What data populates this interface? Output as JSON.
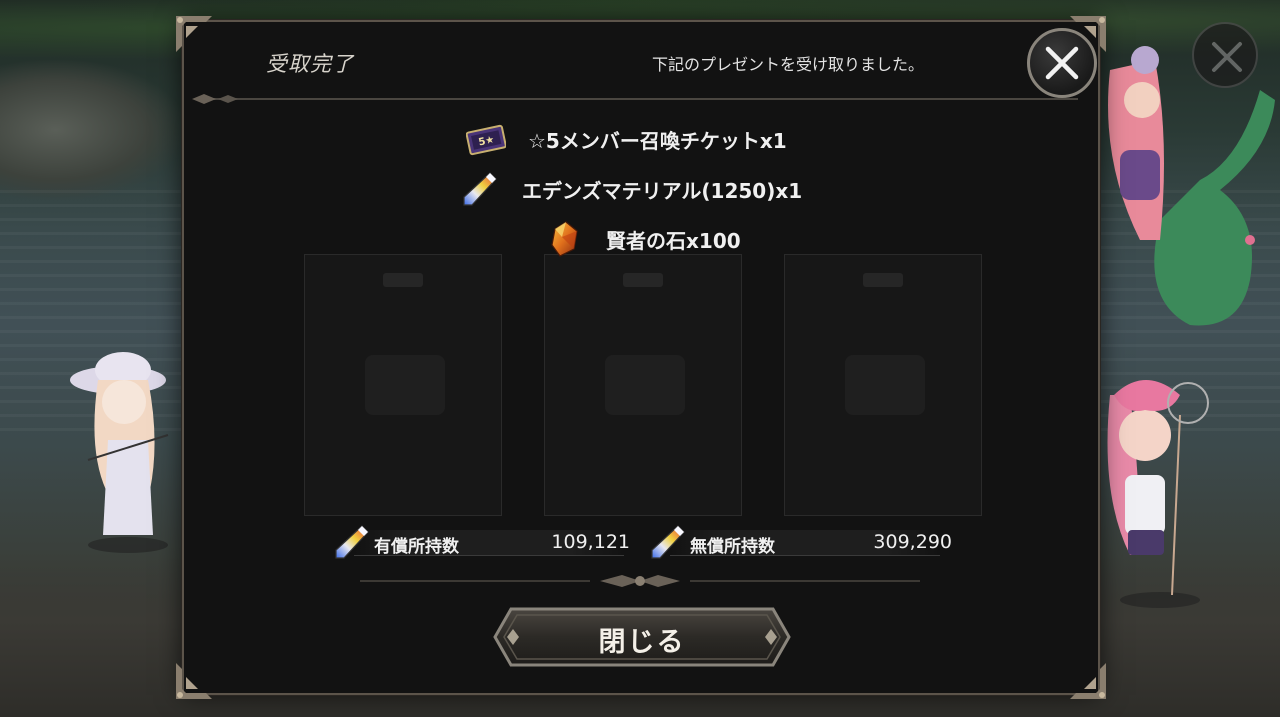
{
  "dialog": {
    "title": "受取完了",
    "subtitle": "下記のプレゼントを受け取りました。",
    "close_icon": "close-x-icon"
  },
  "rewards": [
    {
      "icon": "summon-ticket-icon",
      "label": "☆5メンバー召喚チケットx1",
      "ticket_text": "5★"
    },
    {
      "icon": "eden-material-crystal-icon",
      "label": "エデンズマテリアル(1250)x1"
    },
    {
      "icon": "philosopher-stone-icon",
      "label": "賢者の石x100"
    }
  ],
  "currency": {
    "paid": {
      "icon": "eden-material-crystal-icon",
      "label": "有償所持数",
      "value": "109,121"
    },
    "free": {
      "icon": "eden-material-crystal-icon",
      "label": "無償所持数",
      "value": "309,290"
    }
  },
  "buttons": {
    "close_label": "閉じる"
  },
  "colors": {
    "dialog_bg": "#121212",
    "frame": "#8a857c",
    "text": "#f0f0f0",
    "ticket_purple": "#5a3a8a",
    "stone_orange": "#e0781c"
  }
}
